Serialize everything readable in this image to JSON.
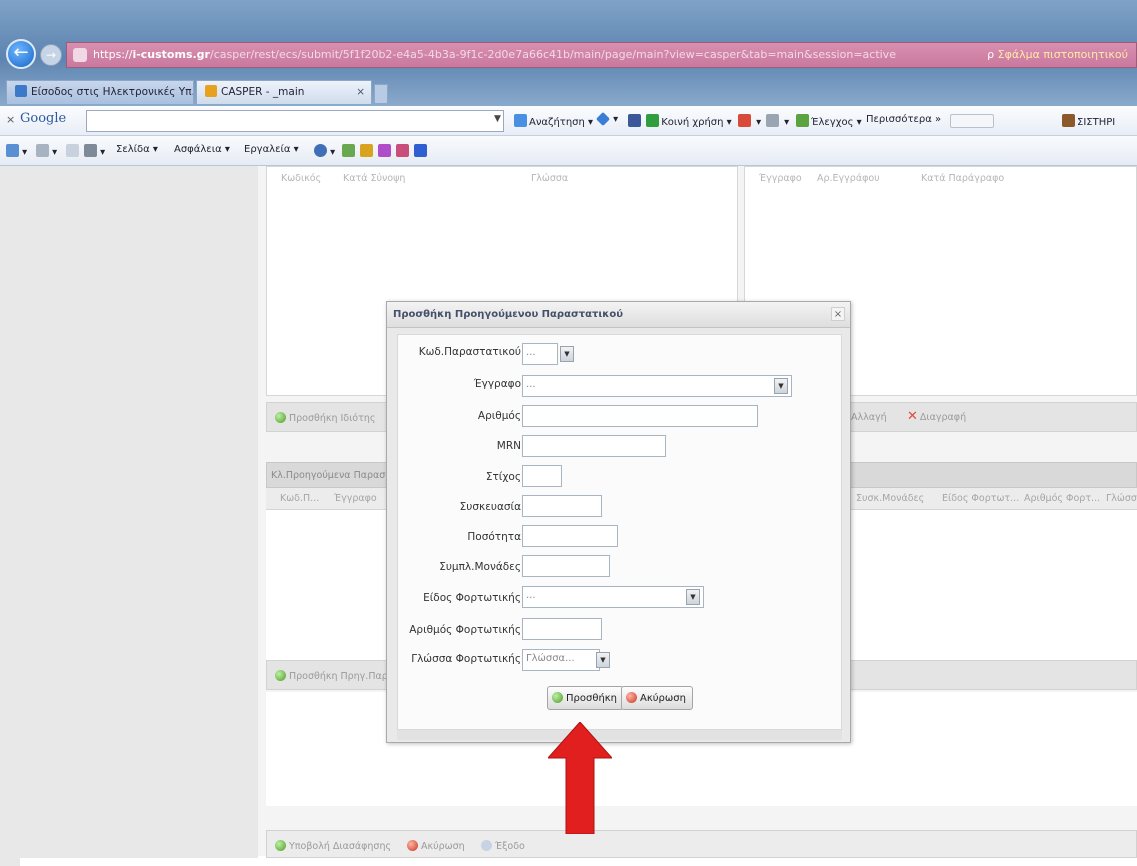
{
  "browser": {
    "url": {
      "prefix": "https://",
      "host": "i-customs.gr",
      "path": "/casper/rest/ecs/submit/5f1f20b2-e4a5-4b3a-9f1c-2d0e7a66c41b/main/page/main?view=casper&tab=main&session=active",
      "search_label": "ρ",
      "error_label": "Σφάλμα πιστοποιητικού"
    },
    "tabs": [
      {
        "label": "Είσοδος στις Ηλεκτρονικές Υπ..."
      },
      {
        "label": "CASPER - _main"
      }
    ],
    "google_toolbar": {
      "logo": "Google",
      "search_button": "Αναζήτηση",
      "share_label": "Κοινή χρήση",
      "check_label": "Έλεγχος",
      "more_label": "Περισσότερα »",
      "sign_in": "ΣΙΣΤΗΡΙ"
    },
    "command_bar": {
      "page_menu": "Σελίδα",
      "safety_menu": "Ασφάλεια",
      "tools_menu": "Εργαλεία"
    }
  },
  "page": {
    "top_grid_headers_left": [
      "Κωδικός",
      "Κατά Σύνοψη",
      "Γλώσσα"
    ],
    "top_grid_headers_right": [
      "Έγγραφο",
      "Αρ.Εγγράφου",
      "Κατά Παράγραφο"
    ],
    "strip1": {
      "add_label": "Προσθήκη Ιδιότης",
      "delete_label": "Διαγραφή",
      "edit_label": "Αλλαγή"
    },
    "section_title": "Κλ.Προηγούμενα Παραστατικά",
    "grid_headers": [
      "Κωδ.Π...",
      "Έγγραφο",
      "Συσκ.Μονάδες",
      "Είδος Φορτωτ...",
      "Αριθμός Φορτ...",
      "Γλώσσ"
    ],
    "strip2": {
      "add_label": "Προσθήκη Πρηγ.Παρ"
    },
    "bottom_buttons": {
      "submit_label": "Υποβολή Διασάφησης",
      "cancel_label": "Ακύρωση",
      "exit_label": "Έξοδο"
    }
  },
  "dialog": {
    "title": "Προσθήκη Προηγούμενου Παραστατικού",
    "close_glyph": "×",
    "fields": {
      "doc_code": {
        "label": "Κωδ.Παραστατικού",
        "value": "..."
      },
      "document": {
        "label": "Έγγραφο",
        "value": "..."
      },
      "number": {
        "label": "Αριθμός",
        "value": ""
      },
      "mrn": {
        "label": "MRN",
        "value": ""
      },
      "item": {
        "label": "Στίχος",
        "value": ""
      },
      "package": {
        "label": "Συσκευασία",
        "value": ""
      },
      "quantity": {
        "label": "Ποσότητα",
        "value": ""
      },
      "supp_units": {
        "label": "Συμπλ.Μονάδες",
        "value": ""
      },
      "bl_type": {
        "label": "Είδος Φορτωτικής",
        "value": "..."
      },
      "bl_number": {
        "label": "Αριθμός Φορτωτικής",
        "value": ""
      },
      "bl_language": {
        "label": "Γλώσσα Φορτωτικής",
        "placeholder": "Γλώσσα..."
      }
    },
    "add_button": "Προσθήκη",
    "cancel_button": "Ακύρωση"
  },
  "colors": {
    "accent_arrow": "#e21f1f",
    "url_bar": "#c9799e",
    "chrome": "#5d84b0"
  },
  "icons": [
    "back-icon",
    "forward-icon",
    "lock-icon",
    "tab-favicon",
    "google-logo",
    "home-icon",
    "print-icon",
    "help-icon",
    "add-icon",
    "cancel-icon",
    "delete-icon",
    "close-icon",
    "arrow-icon"
  ]
}
